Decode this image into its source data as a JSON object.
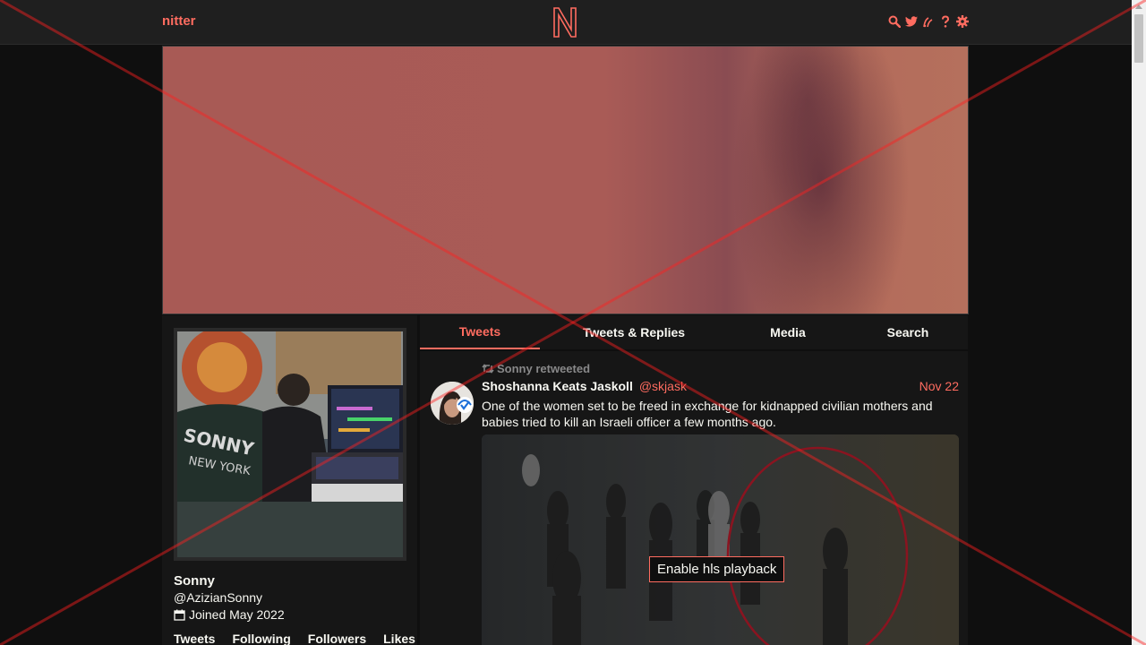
{
  "nav": {
    "brand": "nitter",
    "icons": [
      "search-icon",
      "twitter-bird-icon",
      "rss-icon",
      "help-icon",
      "settings-icon"
    ]
  },
  "profile": {
    "fullname": "Sonny",
    "username": "@AzizianSonny",
    "joined": "Joined May 2022",
    "stats": [
      "Tweets",
      "Following",
      "Followers",
      "Likes"
    ]
  },
  "tabs": [
    {
      "label": "Tweets",
      "active": true
    },
    {
      "label": "Tweets & Replies",
      "active": false
    },
    {
      "label": "Media",
      "active": false
    },
    {
      "label": "Search",
      "active": false
    }
  ],
  "tweet": {
    "retweet_header": "Sonny retweeted",
    "fullname": "Shoshanna Keats Jaskoll",
    "username": "@skjask",
    "date": "Nov 22",
    "text": "One of the women set to be freed in exchange for kidnapped civilian mothers and babies tried to kill an Israeli officer a few months ago.",
    "video_button": "Enable hls playback"
  },
  "colors": {
    "accent": "#ff6c60",
    "background": "#0f0f0f",
    "panel": "#161616",
    "navbar": "#1f1f1f",
    "text": "#f8f8f2",
    "muted": "#888889"
  }
}
